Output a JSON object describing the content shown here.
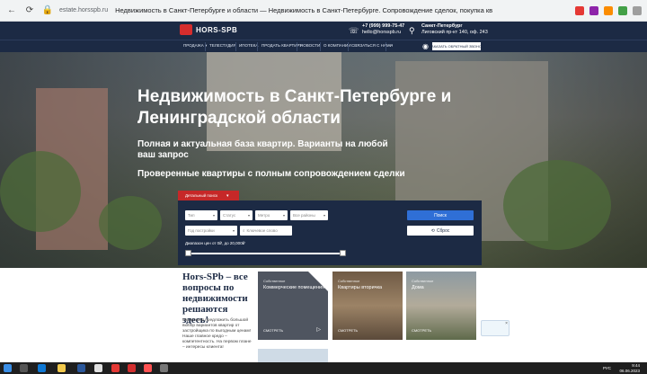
{
  "browser": {
    "url": "estate.horsspb.ru",
    "page_title": "Недвижимость в Санкт-Петербурге и области — Недвижимость в Санкт-Петербурге. Сопровождение сделок, покупка квартиры в новостройке"
  },
  "header": {
    "logo_text": "HORS-SPB",
    "phone": "+7 (999) 999-75-47",
    "email": "hello@horsspb.ru",
    "city": "Санкт-Петербург",
    "address": "Лиговский пр-кт 140, оф. 243"
  },
  "nav": {
    "items": [
      "ПРОДАЖА ▾",
      "ТЕЛЕСТУДИЯ",
      "ИПОТЕКА",
      "ПРОДАТЬ КВАРТИРУ",
      "НОВОСТИ",
      "О КОМПАНИИ",
      "СВЯЗАТЬСЯ С НАМИ",
      "···"
    ],
    "callback_label": "ЗАКАЗАТЬ ОБРАТНЫЙ ЗВОНОК"
  },
  "hero": {
    "title": "Недвижимость в Санкт-Петербурге и Ленинградской области",
    "subtitle1": "Полная и актуальная база квартир. Варианты на любой ваш запрос",
    "subtitle2": "Проверенные квартиры с полным сопровождением сделки"
  },
  "search": {
    "tab_label": "Детальный поиск",
    "fields_row1": [
      "Тип",
      "Статус",
      "Метро",
      "Все районы"
    ],
    "year_field": "Год постройки",
    "keyword_placeholder": "Ключевое слово",
    "search_button": "Поиск",
    "reset_button": "Сброс",
    "price_label": "Диапазон цен от 0₽, до 20,000₽",
    "price_range": {
      "min": 0,
      "max": 20000,
      "low": 0,
      "high": 20000
    }
  },
  "lower": {
    "title": "Hors-SPb – все вопросы по недвижимости решаются здесь!",
    "text": "Мы можем предложить большой выбор вариантов квартир от застройщика по выгодным ценам! Наше главное кредо – компетентность. На первом плане – интересы клиента!"
  },
  "cards": [
    {
      "category": "Собственное",
      "title": "Коммерческие помещения",
      "more": "СМОТРЕТЬ"
    },
    {
      "category": "Собственное",
      "title": "Квартиры вторичка",
      "more": "СМОТРЕТЬ"
    },
    {
      "category": "Собственное",
      "title": "Дома",
      "more": "СМОТРЕТЬ"
    }
  ],
  "taskbar": {
    "lang": "РУС",
    "time": "9:44",
    "date": "06.06.2023"
  },
  "colors": {
    "navy": "#1c2a44",
    "accent_red": "#c62828",
    "button_blue": "#2f6fd6"
  }
}
